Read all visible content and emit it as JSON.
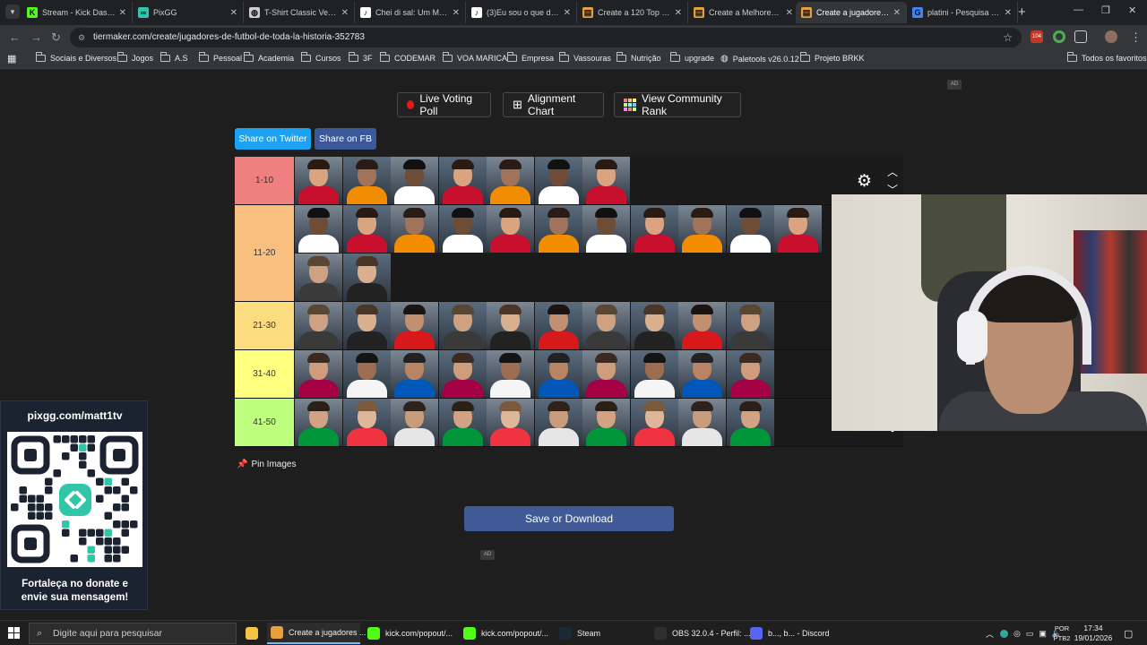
{
  "browser": {
    "tabs": [
      {
        "label": "Stream - Kick Dashbo",
        "icon": "kick-icon",
        "color": "#53fc18",
        "glyph": "K"
      },
      {
        "label": "PixGG",
        "icon": "pixgg-icon",
        "color": "#31c6a8",
        "glyph": "∞"
      },
      {
        "label": "T-Shirt Classic Vectra",
        "icon": "globe-icon",
        "color": "#cfcfcf",
        "glyph": "◍"
      },
      {
        "label": "Chei di sal: Um Meme",
        "icon": "tiktok-icon",
        "color": "#ffffff",
        "glyph": "♪"
      },
      {
        "label": "(3)Eu sou o que desm",
        "icon": "tiktok-icon",
        "color": "#ffffff",
        "glyph": "♪"
      },
      {
        "label": "Create a 120 Top One",
        "icon": "tiermaker-icon",
        "color": "#e8a13a",
        "glyph": "▤"
      },
      {
        "label": "Create a Melhores lu",
        "icon": "tiermaker-icon",
        "color": "#e8a13a",
        "glyph": "▤"
      },
      {
        "label": "Create a jugadores de",
        "icon": "tiermaker-icon",
        "color": "#e8a13a",
        "glyph": "▤"
      },
      {
        "label": "platini - Pesquisa Goo",
        "icon": "google-icon",
        "color": "#4285f4",
        "glyph": "G"
      }
    ],
    "url": "tiermaker.com/create/jugadores-de-futbol-de-toda-la-historia-352783",
    "bookmarks": [
      "Sociais e Diversos",
      "Jogos",
      "A.S",
      "Pessoal",
      "Academia",
      "Cursos",
      "3F",
      "CODEMAR",
      "VOA MARICA",
      "Empresa",
      "Vassouras",
      "Nutrição",
      "upgrade",
      "Paletools v26.0.12",
      "Projeto BRKK"
    ],
    "all_bookmarks": "Todos os favoritos",
    "badge_count": "104"
  },
  "page": {
    "live_voting": "Live Voting Poll",
    "alignment_chart": "Alignment Chart",
    "community_rank": "View Community Rank",
    "share_twitter": "Share on Twitter",
    "share_fb": "Share on FB",
    "pin_images": "Pin Images",
    "save_download": "Save or Download",
    "ad_label": "AD"
  },
  "tiers": [
    {
      "label": "1-10",
      "color": "#f07f7f",
      "count": 7
    },
    {
      "label": "11-20",
      "color": "#f9bf7f",
      "count": 13
    },
    {
      "label": "21-30",
      "color": "#fbdc7f",
      "count": 10
    },
    {
      "label": "31-40",
      "color": "#ffff7f",
      "count": 10
    },
    {
      "label": "41-50",
      "color": "#bfff7f",
      "count": 10
    }
  ],
  "overlay": {
    "qr_top": "pixgg.com/matt1tv",
    "qr_bottom_line1": "Fortaleça no donate e",
    "qr_bottom_line2": "envie sua mensagem!"
  },
  "taskbar": {
    "search_placeholder": "Digite aqui para pesquisar",
    "items": [
      {
        "label": "Create a jugadores ...",
        "color": "#e8a13a"
      },
      {
        "label": "kick.com/popout/...",
        "color": "#53fc18"
      },
      {
        "label": "kick.com/popout/...",
        "color": "#53fc18"
      },
      {
        "label": "Steam",
        "color": "#1b2838"
      },
      {
        "label": "OBS 32.0.4 - Perfil: ...",
        "color": "#302e31"
      },
      {
        "label": "b..., b... - Discord",
        "color": "#5865f2"
      }
    ],
    "lang1": "POR",
    "lang2": "PTB2",
    "time": "17:34",
    "date": "19/01/2026"
  }
}
